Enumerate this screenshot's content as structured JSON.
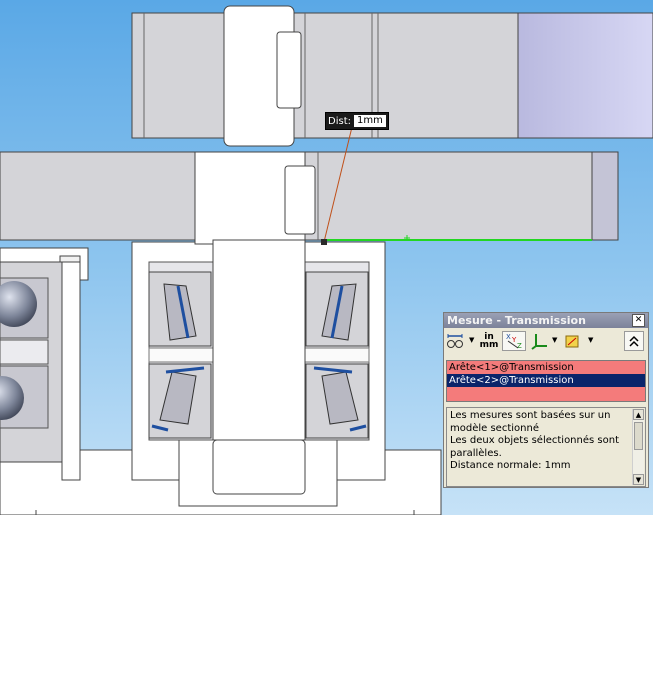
{
  "measure_tooltip": {
    "label": "Dist:",
    "value": "1mm"
  },
  "measure_panel": {
    "title": "Mesure - Transmission",
    "close_glyph": "✕",
    "toolbar": {
      "units_top": "in",
      "units_bottom": "mm",
      "xyz_label": "XYZ",
      "icons": [
        "arc-circle-options-icon",
        "units-precision-icon",
        "xyz-measure-icon",
        "projection-icon",
        "coordinate-system-icon",
        "collapse-icon"
      ]
    },
    "selections": [
      {
        "label": "Arête<1>@Transmission",
        "highlighted": false
      },
      {
        "label": "Arête<2>@Transmission",
        "highlighted": true
      }
    ],
    "results": [
      "Les mesures sont basées sur un modèle sectionné",
      "Les deux objets sélectionnés sont parallèles.",
      "Distance normale: 1mm"
    ]
  },
  "colors": {
    "sky_top": "#5aa8e6",
    "part_gray": "#d4d4d8",
    "bearing_blue": "#1e4fa0",
    "selection_green": "#22d622",
    "leader_line": "#c0501a",
    "selection_list": "#f47b7b",
    "selection_highlight": "#0a246a"
  }
}
